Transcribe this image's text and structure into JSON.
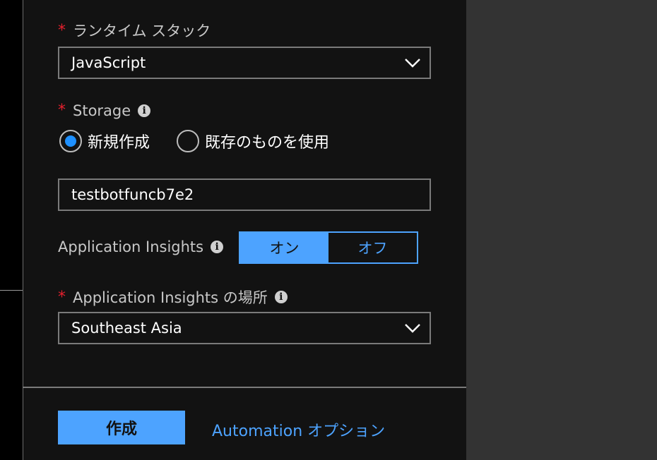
{
  "runtime": {
    "required_mark": "*",
    "label": "ランタイム スタック",
    "value": "JavaScript",
    "chevron_icon": "chevron-down-icon"
  },
  "storage": {
    "required_mark": "*",
    "label": "Storage",
    "info_icon": "info-icon",
    "options": [
      {
        "label": "新規作成",
        "selected": true
      },
      {
        "label": "既存のものを使用",
        "selected": false
      }
    ],
    "name_value": "testbotfuncb7e2"
  },
  "app_insights": {
    "label": "Application Insights",
    "info_icon": "info-icon",
    "on_label": "オン",
    "off_label": "オフ",
    "selected": "on"
  },
  "app_insights_location": {
    "required_mark": "*",
    "label": "Application Insights の場所",
    "info_icon": "info-icon",
    "value": "Southeast Asia",
    "chevron_icon": "chevron-down-icon"
  },
  "footer": {
    "create_label": "作成",
    "automation_link": "Automation オプション"
  },
  "colors": {
    "accent": "#4da3ff",
    "required": "#e5202e",
    "panel_bg": "#121212",
    "side_bg": "#333333"
  }
}
